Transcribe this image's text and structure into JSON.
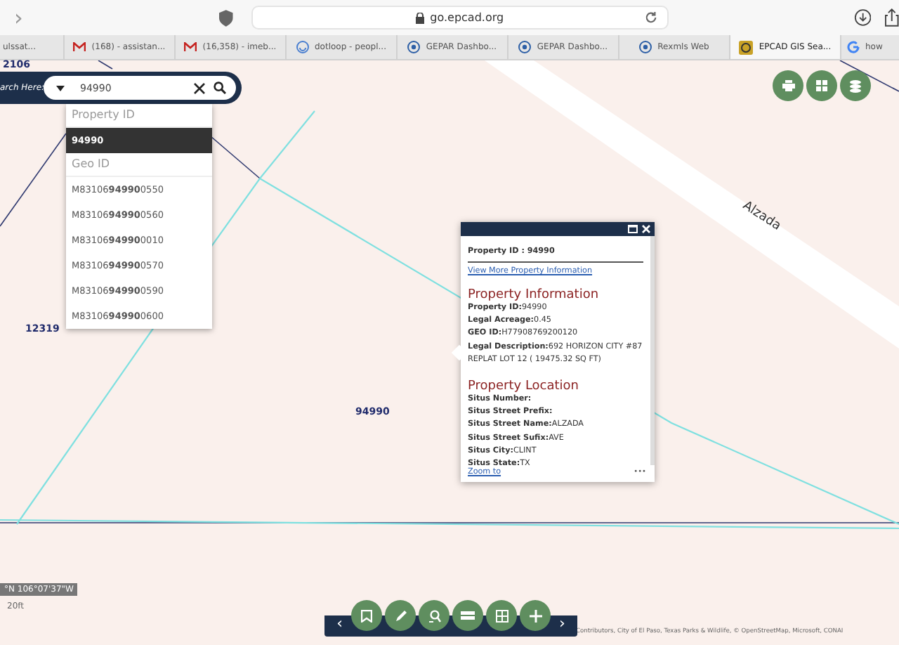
{
  "browser": {
    "forward": "›",
    "url": "go.epcad.org",
    "tabs": [
      {
        "label": "ulssat...",
        "selected": false
      },
      {
        "label": "(168) - assistan...",
        "selected": false
      },
      {
        "label": "(16,358) - imeb...",
        "selected": false
      },
      {
        "label": "dotloop - peopl...",
        "selected": false
      },
      {
        "label": "GEPAR Dashbo...",
        "selected": false
      },
      {
        "label": "GEPAR Dashbo...",
        "selected": false
      },
      {
        "label": "Rexmls Web",
        "selected": false
      },
      {
        "label": "EPCAD GIS Sea...",
        "selected": true
      },
      {
        "label": "how",
        "selected": false
      }
    ]
  },
  "toolbar": {
    "previous": "‹",
    "next": "›"
  },
  "map": {
    "labels": [
      {
        "text": "2106"
      },
      {
        "text": "12319"
      },
      {
        "text": "94990"
      },
      {
        "text": "Alzada"
      }
    ],
    "coordinates": "°N 106°07'37\"W",
    "scale": "20ft",
    "attribution": "Contributors, City of El Paso, Texas Parks & Wildlife, © OpenStreetMap, Microsoft, CONAI"
  },
  "search": {
    "label": "arch Here:",
    "value": "94990",
    "groups": [
      {
        "heading": "Property ID",
        "items": [
          {
            "text": "94990",
            "selected": true
          }
        ]
      },
      {
        "heading": "Geo ID",
        "items": [
          {
            "text": "M83106**94990**0550",
            "selected": false
          },
          {
            "text": "M83106**94990**0560",
            "selected": false
          },
          {
            "text": "M83106**94990**0010",
            "selected": false
          },
          {
            "text": "M83106**94990**0570",
            "selected": false
          },
          {
            "text": "M83106**94990**0590",
            "selected": false
          },
          {
            "text": "M83106**94990**0600",
            "selected": false
          }
        ]
      }
    ]
  },
  "popup": {
    "title": "Property ID : 94990",
    "link": "View More Property Information",
    "sections": [
      {
        "title": "Property Information",
        "fields": [
          {
            "label": "Property ID:",
            "value": "94990"
          },
          {
            "label": "Legal Acreage:",
            "value": "0.45"
          },
          {
            "label": "GEO ID:",
            "value": "H77908769200120"
          },
          {
            "label": "Legal Description:",
            "value": "692 HORIZON CITY #87 REPLAT LOT 12 ( 19475.32 SQ FT)"
          }
        ]
      },
      {
        "title": "Property Location",
        "fields": [
          {
            "label": "Situs Number:"
          },
          {
            "label": "Situs Street Prefix:"
          },
          {
            "label": "Situs Street Name:",
            "value": "ALZADA"
          },
          {
            "label": "Situs Street Sufix:",
            "value": "AVE"
          },
          {
            "label": "Situs City:",
            "value": "CLINT"
          },
          {
            "label": "Situs State:",
            "value": "TX"
          }
        ]
      }
    ],
    "zoom_link": "Zoom to",
    "more": "•••"
  }
}
